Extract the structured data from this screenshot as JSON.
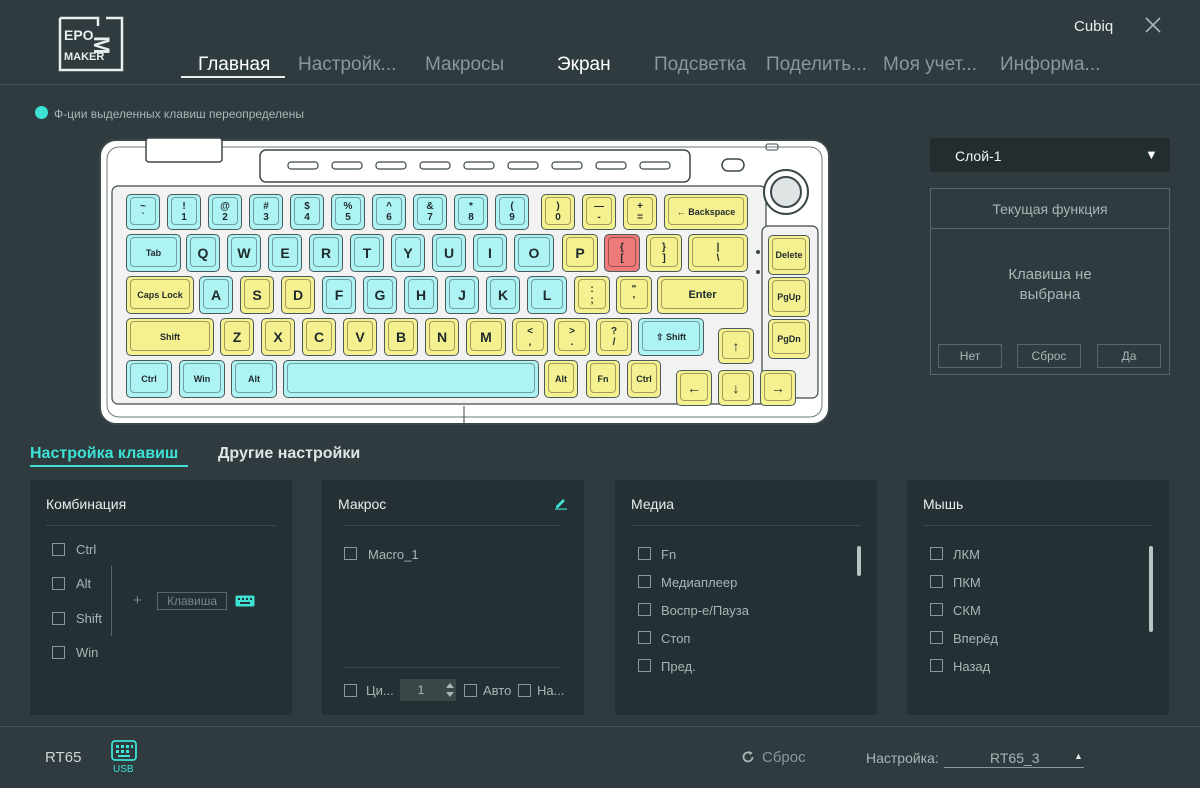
{
  "header": {
    "brand": "Cubiq",
    "tabs": [
      "Главная",
      "Настройк...",
      "Макросы",
      "Экран",
      "Подсветка",
      "Поделить...",
      "Моя учет...",
      "Информа..."
    ],
    "active_tab": "Главная"
  },
  "remap_note": "Ф-ции выделенных клавиш переопределены",
  "keyboard": {
    "rows": [
      [
        {
          "t": "~\n`",
          "c": "c"
        },
        {
          "t": "!\n1",
          "c": "c"
        },
        {
          "t": "@\n2",
          "c": "c"
        },
        {
          "t": "#\n3",
          "c": "c"
        },
        {
          "t": "$\n4",
          "c": "c"
        },
        {
          "t": "%\n5",
          "c": "c"
        },
        {
          "t": "^\n6",
          "c": "c"
        },
        {
          "t": "&\n7",
          "c": "c"
        },
        {
          "t": "*\n8",
          "c": "c"
        },
        {
          "t": "(\n9",
          "c": "c"
        },
        {
          "t": ")\n0",
          "c": "y"
        },
        {
          "t": "—\n-",
          "c": "y"
        },
        {
          "t": "+\n=",
          "c": "y"
        },
        {
          "t": "← Backspace",
          "c": "y"
        }
      ],
      [
        {
          "t": "Tab",
          "c": "c"
        },
        {
          "t": "Q",
          "c": "c"
        },
        {
          "t": "W",
          "c": "c"
        },
        {
          "t": "E",
          "c": "c"
        },
        {
          "t": "R",
          "c": "c"
        },
        {
          "t": "T",
          "c": "c"
        },
        {
          "t": "Y",
          "c": "c"
        },
        {
          "t": "U",
          "c": "c"
        },
        {
          "t": "I",
          "c": "c"
        },
        {
          "t": "O",
          "c": "c"
        },
        {
          "t": "P",
          "c": "y"
        },
        {
          "t": "{\n[",
          "c": "r"
        },
        {
          "t": "}\n]",
          "c": "y"
        },
        {
          "t": "|\n\\",
          "c": "y"
        },
        {
          "t": "Delete",
          "c": "y"
        }
      ],
      [
        {
          "t": "Caps Lock",
          "c": "y"
        },
        {
          "t": "A",
          "c": "c"
        },
        {
          "t": "S",
          "c": "y"
        },
        {
          "t": "D",
          "c": "y"
        },
        {
          "t": "F",
          "c": "c"
        },
        {
          "t": "G",
          "c": "c"
        },
        {
          "t": "H",
          "c": "c"
        },
        {
          "t": "J",
          "c": "c"
        },
        {
          "t": "K",
          "c": "c"
        },
        {
          "t": "L",
          "c": "c"
        },
        {
          "t": ":\n;",
          "c": "y"
        },
        {
          "t": "\"\n'",
          "c": "y"
        },
        {
          "t": "Enter",
          "c": "y"
        },
        {
          "t": "PgUp",
          "c": "y"
        }
      ],
      [
        {
          "t": "Shift",
          "c": "y"
        },
        {
          "t": "Z",
          "c": "y"
        },
        {
          "t": "X",
          "c": "y"
        },
        {
          "t": "C",
          "c": "y"
        },
        {
          "t": "V",
          "c": "y"
        },
        {
          "t": "B",
          "c": "y"
        },
        {
          "t": "N",
          "c": "y"
        },
        {
          "t": "M",
          "c": "y"
        },
        {
          "t": "<\n,",
          "c": "y"
        },
        {
          "t": ">\n.",
          "c": "y"
        },
        {
          "t": "?\n/",
          "c": "y"
        },
        {
          "t": "⇧ Shift",
          "c": "c"
        },
        {
          "t": "↑",
          "c": "y"
        },
        {
          "t": "PgDn",
          "c": "y"
        }
      ],
      [
        {
          "t": "Ctrl",
          "c": "c"
        },
        {
          "t": "Win",
          "c": "c"
        },
        {
          "t": "Alt",
          "c": "c"
        },
        {
          "t": "",
          "c": "c"
        },
        {
          "t": "Alt",
          "c": "y"
        },
        {
          "t": "Fn",
          "c": "y"
        },
        {
          "t": "Ctrl",
          "c": "y"
        },
        {
          "t": "←",
          "c": "y"
        },
        {
          "t": "↓",
          "c": "y"
        },
        {
          "t": "→",
          "c": "y"
        }
      ]
    ]
  },
  "layer": {
    "label": "Слой-1",
    "arrow": "▼"
  },
  "current_function": {
    "title": "Текущая функция",
    "empty": "Клавиша не\nвыбрана",
    "buttons": {
      "no": "Нет",
      "reset": "Сброс",
      "yes": "Да"
    }
  },
  "section_tabs": {
    "keys": "Настройка клавиш",
    "other": "Другие настройки"
  },
  "combo": {
    "title": "Комбинация",
    "modifiers": [
      "Ctrl",
      "Alt",
      "Shift",
      "Win"
    ],
    "plus": "+",
    "key_placeholder": "Клавиша"
  },
  "macro": {
    "title": "Макрос",
    "items": [
      "Macro_1"
    ],
    "cycle_label": "Ци...",
    "count": "1",
    "auto_label": "Авто",
    "na_label": "На..."
  },
  "media": {
    "title": "Медиа",
    "items": [
      "Fn",
      "Медиаплеер",
      "Воспр-е/Пауза",
      "Стоп",
      "Пред."
    ]
  },
  "mouse": {
    "title": "Мышь",
    "items": [
      "ЛКМ",
      "ПКМ",
      "СКМ",
      "Вперёд",
      "Назад"
    ]
  },
  "footer": {
    "device": "RT65",
    "connection": "USB",
    "reset": "Сброс",
    "profile_label": "Настройка:",
    "profile_value": "RT65_3"
  },
  "colors": {
    "accent": "#3ee2d5",
    "key_cyan": "#aef3f3",
    "key_yellow": "#f5f090",
    "key_red": "#ee7a7a",
    "bg": "#2f3b3e",
    "panel": "#243033"
  }
}
